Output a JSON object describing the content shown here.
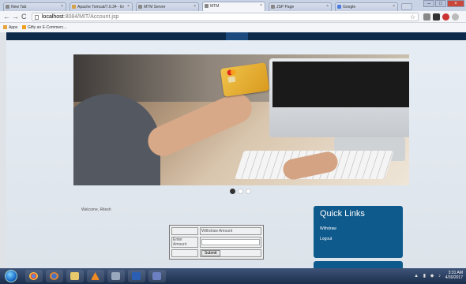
{
  "browser": {
    "tabs": [
      {
        "label": "New Tab",
        "active": false
      },
      {
        "label": "Apache Tomcat/7.0.34 - Er",
        "active": false
      },
      {
        "label": "MTM Server",
        "active": false
      },
      {
        "label": "MTM",
        "active": true
      },
      {
        "label": "JSP Page",
        "active": false
      },
      {
        "label": "Google",
        "active": false
      }
    ],
    "url_host": "localhost",
    "url_rest": ":8084/MIT/Account.jsp",
    "bookmarks": [
      {
        "label": "Apps",
        "color": "#e8a33b"
      },
      {
        "label": "Gifty an E-Commerc...",
        "color": "#f0a020"
      }
    ]
  },
  "page": {
    "welcome": "Welcome, Ritesh",
    "slider_dots": 3,
    "slider_active": 0,
    "withdraw_form": {
      "header": "Withdraw Amount",
      "amount_label": "Enter Amount",
      "amount_value": "",
      "submit_label": "Submit"
    },
    "quick_links": {
      "title": "Quick Links",
      "links": [
        "Withdraw",
        "Logout"
      ]
    }
  },
  "taskbar": {
    "time": "3:31 AM",
    "date": "4/30/2017"
  },
  "colors": {
    "header_navy": "#0e2a4a",
    "quicklinks_blue": "#0f5a8c"
  }
}
